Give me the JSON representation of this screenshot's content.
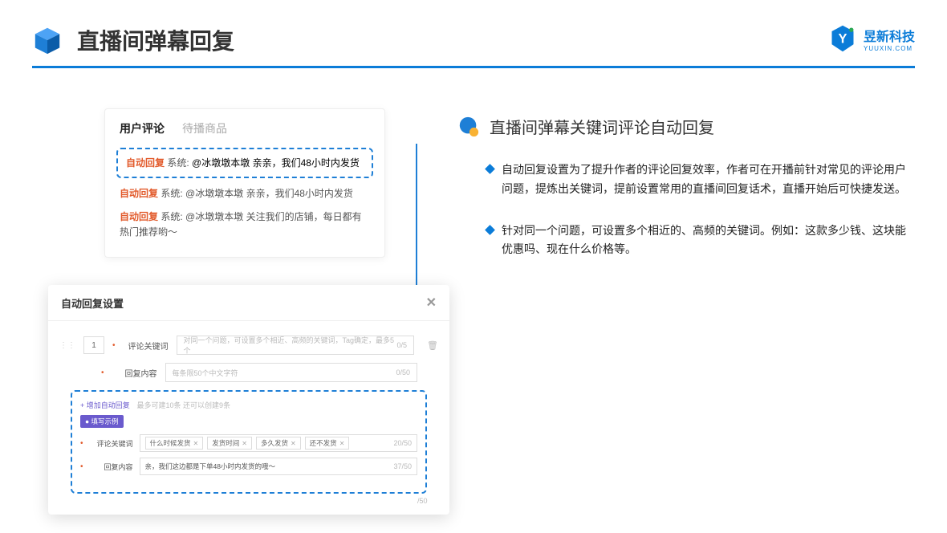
{
  "header": {
    "title": "直播间弹幕回复",
    "brand_cn": "昱新科技",
    "brand_en": "YUUXIN.COM"
  },
  "comments_panel": {
    "tab_active": "用户评论",
    "tab_inactive": "待播商品",
    "highlighted": {
      "tag": "自动回复",
      "system": "系统:",
      "text": "@冰墩墩本墩 亲亲，我们48小时内发货"
    },
    "line2": {
      "tag": "自动回复",
      "system": "系统:",
      "text": "@冰墩墩本墩 亲亲，我们48小时内发货"
    },
    "line3": {
      "tag": "自动回复",
      "system": "系统:",
      "text": "@冰墩墩本墩 关注我们的店铺，每日都有热门推荐哟～"
    }
  },
  "modal": {
    "title": "自动回复设置",
    "index": "1",
    "kw_label": "评论关键词",
    "kw_placeholder": "对同一个问题，可设置多个相近、高频的关键词，Tag确定，最多5个",
    "kw_counter": "0/5",
    "content_label": "回复内容",
    "content_placeholder": "每条限50个中文字符",
    "content_counter": "0/50",
    "add_link": "+ 增加自动回复",
    "add_hint": "最多可建10条 还可以创建9条",
    "example_badge": "● 填写示例",
    "example_kw_label": "评论关键词",
    "example_tags": [
      "什么时候发货",
      "发货时间",
      "多久发货",
      "还不发货"
    ],
    "example_kw_counter": "20/50",
    "example_content_label": "回复内容",
    "example_content_value": "亲，我们这边都是下单48小时内发货的哦～",
    "example_content_counter": "37/50",
    "scroll_stub": "/50"
  },
  "right": {
    "title": "直播间弹幕关键词评论自动回复",
    "bullet1": "自动回复设置为了提升作者的评论回复效率，作者可在开播前针对常见的评论用户问题，提炼出关键词，提前设置常用的直播间回复话术，直播开始后可快捷发送。",
    "bullet2": "针对同一个问题，可设置多个相近的、高频的关键词。例如：这款多少钱、这块能优惠吗、现在什么价格等。"
  }
}
